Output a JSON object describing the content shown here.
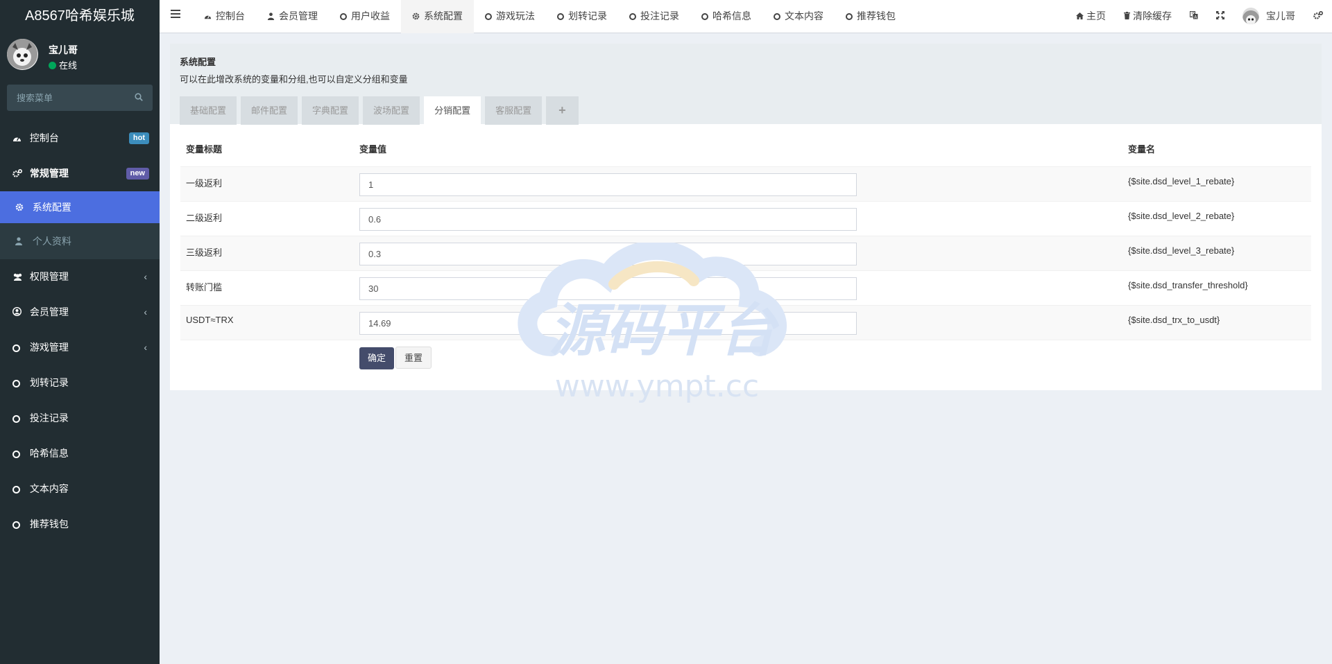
{
  "app": {
    "brand": "A8567哈希娱乐城"
  },
  "user": {
    "name": "宝儿哥",
    "status": "在线"
  },
  "search": {
    "placeholder": "搜索菜单"
  },
  "sidebar": {
    "items": [
      {
        "label": "控制台",
        "icon": "dashboard-icon",
        "badge": "hot",
        "badge_color": "#3c8dbc"
      },
      {
        "label": "常规管理",
        "icon": "cogs-icon",
        "badge": "new",
        "badge_color": "#605ca8"
      },
      {
        "label": "系统配置",
        "icon": "gear-icon"
      },
      {
        "label": "个人资料",
        "icon": "user-icon"
      },
      {
        "label": "权限管理",
        "icon": "users-icon"
      },
      {
        "label": "会员管理",
        "icon": "user-circle-icon"
      },
      {
        "label": "游戏管理",
        "icon": "circle-icon"
      },
      {
        "label": "划转记录",
        "icon": "circle-icon"
      },
      {
        "label": "投注记录",
        "icon": "circle-icon"
      },
      {
        "label": "哈希信息",
        "icon": "circle-icon"
      },
      {
        "label": "文本内容",
        "icon": "circle-icon"
      },
      {
        "label": "推荐钱包",
        "icon": "circle-icon"
      }
    ]
  },
  "topnav": {
    "tabs": [
      {
        "label": "控制台",
        "icon": "dashboard-icon"
      },
      {
        "label": "会员管理",
        "icon": "user-icon"
      },
      {
        "label": "用户收益",
        "icon": "circle-icon"
      },
      {
        "label": "系统配置",
        "icon": "gear-icon"
      },
      {
        "label": "游戏玩法",
        "icon": "circle-icon"
      },
      {
        "label": "划转记录",
        "icon": "circle-icon"
      },
      {
        "label": "投注记录",
        "icon": "circle-icon"
      },
      {
        "label": "哈希信息",
        "icon": "circle-icon"
      },
      {
        "label": "文本内容",
        "icon": "circle-icon"
      },
      {
        "label": "推荐钱包",
        "icon": "circle-icon"
      }
    ],
    "home": "主页",
    "clear_cache": "清除缓存",
    "user_name": "宝儿哥"
  },
  "panel": {
    "title": "系统配置",
    "description": "可以在此增改系统的变量和分组,也可以自定义分组和变量",
    "tabs": [
      "基础配置",
      "邮件配置",
      "字典配置",
      "波场配置",
      "分销配置",
      "客服配置",
      "+"
    ],
    "active_tab": "分销配置"
  },
  "table": {
    "headers": [
      "变量标题",
      "变量值",
      "变量名"
    ],
    "rows": [
      {
        "title": "一级返利",
        "value": "1",
        "name": "{$site.dsd_level_1_rebate}"
      },
      {
        "title": "二级返利",
        "value": "0.6",
        "name": "{$site.dsd_level_2_rebate}"
      },
      {
        "title": "三级返利",
        "value": "0.3",
        "name": "{$site.dsd_level_3_rebate}"
      },
      {
        "title": "转账门槛",
        "value": "30",
        "name": "{$site.dsd_transfer_threshold}"
      },
      {
        "title": "USDT≈TRX",
        "value": "14.69",
        "name": "{$site.dsd_trx_to_usdt}"
      }
    ]
  },
  "buttons": {
    "confirm": "确定",
    "reset": "重置"
  },
  "watermark": {
    "title": "源码平台",
    "url": "www.ympt.cc"
  },
  "colors": {
    "sidebar_bg": "#222d32",
    "active_menu": "#4c6ee0",
    "primary_button": "#444c6b",
    "online": "#00a65a"
  }
}
